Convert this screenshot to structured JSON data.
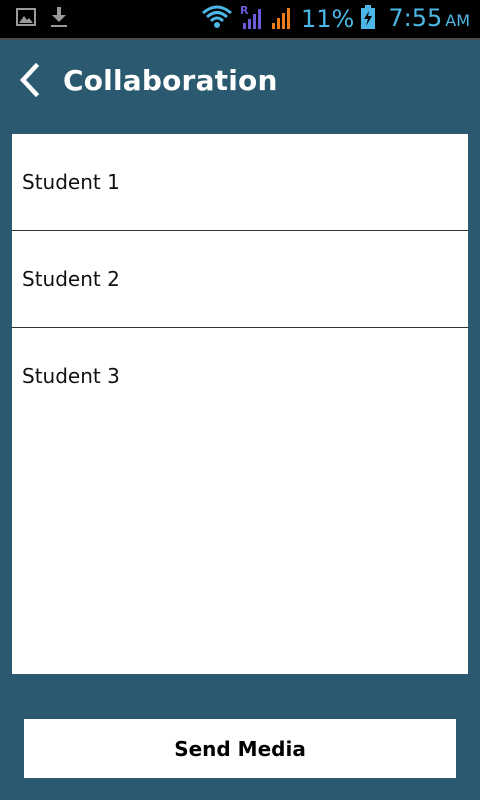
{
  "status_bar": {
    "battery_percent": "11%",
    "time": "7:55",
    "ampm": "AM",
    "icons": {
      "left": [
        "image-icon",
        "download-icon"
      ],
      "right": [
        "wifi-icon",
        "roaming-signal-icon",
        "signal-icon",
        "battery-charging-icon"
      ]
    },
    "colors": {
      "background": "#000000",
      "accent": "#4cb7e6",
      "signal_orange": "#f07d1a",
      "roaming_purple": "#6a5bd6"
    }
  },
  "header": {
    "title": "Collaboration",
    "back_icon": "chevron-left-icon"
  },
  "collaborators": {
    "items": [
      {
        "label": "Student 1"
      },
      {
        "label": "Student 2"
      },
      {
        "label": "Student 3"
      }
    ]
  },
  "footer": {
    "send_label": "Send Media"
  },
  "theme": {
    "background": "#2b5a70",
    "panel": "#ffffff",
    "divider": "#333333"
  }
}
